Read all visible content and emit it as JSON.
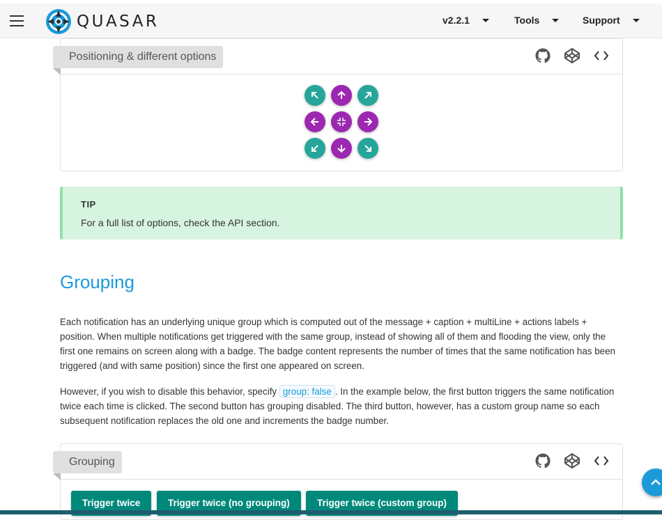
{
  "header": {
    "logo_text": "QUASAR",
    "version_menu": "v2.2.1",
    "tools_menu": "Tools",
    "support_menu": "Support"
  },
  "positioning_card": {
    "title": "Positioning & different options",
    "icons": [
      "github-icon",
      "codepen-icon",
      "code-icon"
    ],
    "buttons": [
      {
        "name": "top-left",
        "color": "#26a69a"
      },
      {
        "name": "top",
        "color": "#9c27b0"
      },
      {
        "name": "top-right",
        "color": "#26a69a"
      },
      {
        "name": "left",
        "color": "#9c27b0"
      },
      {
        "name": "center",
        "color": "#9c27b0"
      },
      {
        "name": "right",
        "color": "#9c27b0"
      },
      {
        "name": "bottom-left",
        "color": "#26a69a"
      },
      {
        "name": "bottom",
        "color": "#9c27b0"
      },
      {
        "name": "bottom-right",
        "color": "#26a69a"
      }
    ]
  },
  "tip": {
    "title": "TIP",
    "text": "For a full list of options, check the API section."
  },
  "grouping": {
    "heading": "Grouping",
    "para1": "Each notification has an underlying unique group which is computed out of the message + caption + multiLine + actions labels + position. When multiple notifications get triggered with the same group, instead of showing all of them and flooding the view, only the first one remains on screen along with a badge. The badge content represents the number of times that the same notification has been triggered (and with same position) since the first one appeared on screen.",
    "para2_before": "However, if you wish to disable this behavior, specify ",
    "para2_code": "group: false",
    "para2_after": ". In the example below, the first button triggers the same notification twice each time is clicked. The second button has grouping disabled. The third button, however, has a custom group name so each subsequent notification replaces the old one and increments the badge number.",
    "card_title": "Grouping",
    "buttons": [
      "Trigger twice",
      "Trigger twice (no grouping)",
      "Trigger twice (custom group)"
    ]
  },
  "colors": {
    "accent": "#1c9ad8",
    "teal": "#26a69a",
    "purple": "#9c27b0",
    "button": "#00897b",
    "tip_bg": "#d7f4e0"
  }
}
